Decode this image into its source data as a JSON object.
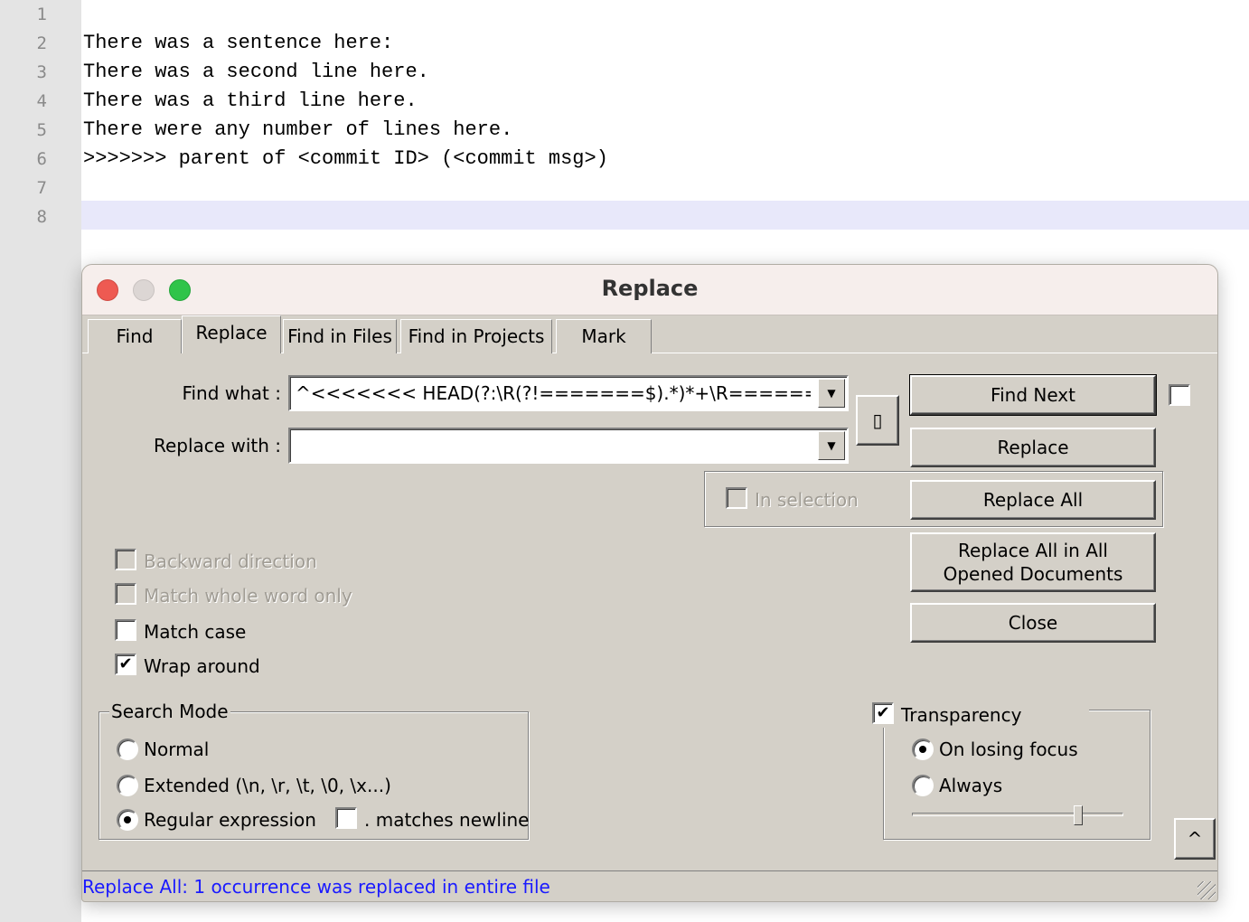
{
  "editor": {
    "line_numbers": [
      "1",
      "2",
      "3",
      "4",
      "5",
      "6",
      "7",
      "8"
    ],
    "lines": [
      "",
      "There was a sentence here:",
      "There was a second line here.",
      "There was a third line here.",
      "There were any number of lines here.",
      ">>>>>>> parent of <commit ID> (<commit msg>)",
      "",
      ""
    ]
  },
  "dialog": {
    "title": "Replace",
    "tabs": [
      {
        "label": "Find"
      },
      {
        "label": "Replace",
        "active": true
      },
      {
        "label": "Find in Files"
      },
      {
        "label": "Find in Projects"
      },
      {
        "label": "Mark"
      }
    ],
    "find_what_label": "Find what :",
    "find_what_value": "^<<<<<<< HEAD(?:\\R(?!=======$).*)*+\\R======",
    "replace_with_label": "Replace with :",
    "replace_with_value": "",
    "swap_button": "▯",
    "buttons": {
      "find_next": "Find Next",
      "replace": "Replace",
      "replace_all": "Replace All",
      "replace_all_docs_1": "Replace All in All",
      "replace_all_docs_2": "Opened Documents",
      "close": "Close",
      "collapse": "^"
    },
    "in_selection": "In selection",
    "options": {
      "backward": "Backward direction",
      "whole_word": "Match whole word only",
      "match_case": "Match case",
      "wrap": "Wrap around"
    },
    "search_mode": {
      "label": "Search Mode",
      "normal": "Normal",
      "extended": "Extended (\\n, \\r, \\t, \\0, \\x...)",
      "regex": "Regular expression",
      "dot_newline": ". matches newline",
      "selected": "regex"
    },
    "transparency": {
      "label": "Transparency",
      "checked": true,
      "on_losing_focus": "On losing focus",
      "always": "Always",
      "selected": "on_losing_focus",
      "slider_value": 0.8
    },
    "status": "Replace All: 1 occurrence was replaced in entire file"
  }
}
